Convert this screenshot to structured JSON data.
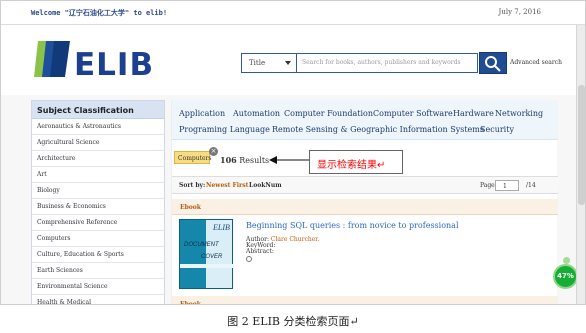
{
  "top_bar": {
    "welcome": "Welcome \"辽宁石油化工大学\" to elib!",
    "date": "July 7, 2016"
  },
  "logo": {
    "text": "ELIB"
  },
  "search": {
    "type_selected": "Title",
    "placeholder": "Search for books, authors, publishers and keywords",
    "advanced_label": "Advanced search"
  },
  "sidebar": {
    "title": "Subject Classification",
    "items": [
      "Aeronautics & Astronautics",
      "Agricultural Science",
      "Architecture",
      "Art",
      "Biology",
      "Business & Economics",
      "Comprehensive Reference",
      "Computers",
      "Culture, Education & Sports",
      "Earth Sciences",
      "Environmental Science",
      "Health & Medical"
    ]
  },
  "categories": {
    "row1": [
      "Application",
      "Automation",
      "Computer Foundation",
      "Computer Software",
      "Hardware",
      "Networking"
    ],
    "row2": [
      "Programing Language",
      "Remote Sensing & Geographic Information Systems",
      "Security"
    ]
  },
  "results": {
    "active_tag": "Computers",
    "close_symbol": "×",
    "count": "106",
    "count_label": "Results"
  },
  "sort_bar": {
    "label": "Sort by:",
    "active": "Newest First",
    "other": "LookNum",
    "page_label": "Page",
    "page_value": "1",
    "page_total": "/14"
  },
  "ebook": {
    "label": "Ebook"
  },
  "book": {
    "cover_brand": "ELIB",
    "cover_line1": "DOCUMENT",
    "cover_line2": "COVER",
    "title": "Beginning SQL queries : from novice to professional",
    "author_label": "Author:",
    "author_name": "Clare  Churcher.",
    "keyword_label": "KeyWord:",
    "abstract_label": "Abstract:"
  },
  "annotation": {
    "callout": "显示检索结果↵"
  },
  "progress": {
    "percent": "47%"
  },
  "caption": "图 2  ELIB 分类检索页面↵"
}
